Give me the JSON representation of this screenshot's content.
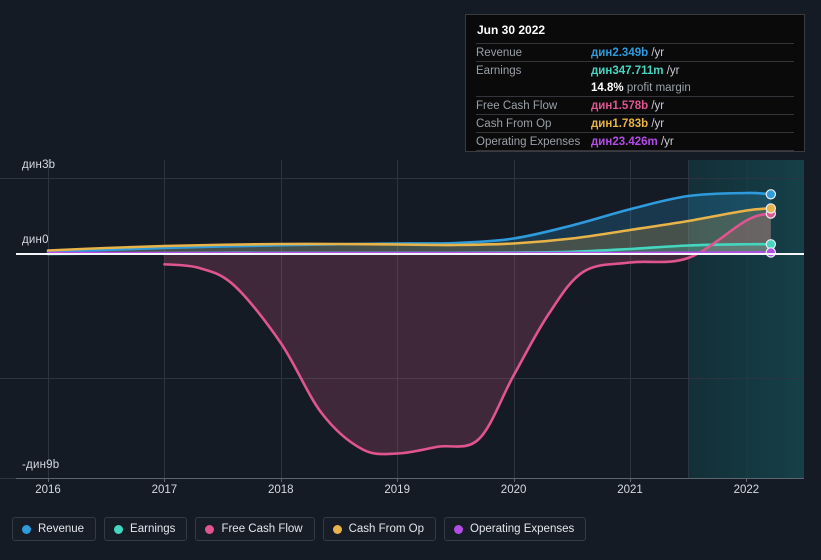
{
  "chart_data": {
    "type": "area",
    "title": "",
    "xlabel": "",
    "ylabel": "",
    "currency": "дин",
    "grid": true,
    "legend_position": "bottom-left",
    "xlim": [
      2015.72,
      2022.21
    ],
    "ylim": [
      -9,
      3
    ],
    "x_ticks": [
      2016,
      2017,
      2018,
      2019,
      2020,
      2021,
      2022
    ],
    "x_tick_labels": [
      "2016",
      "2017",
      "2018",
      "2019",
      "2020",
      "2021",
      "2022"
    ],
    "y_ticks": [
      3,
      0,
      -5,
      -9
    ],
    "y_tick_labels": [
      "дин3b",
      "дин0",
      "",
      "-дин9b"
    ],
    "forecast_start": 2021.5,
    "series": [
      {
        "name": "Revenue",
        "color": "#2e9bdd",
        "x": [
          2016.0,
          2016.5,
          2017.0,
          2017.5,
          2018.0,
          2018.5,
          2019.0,
          2019.5,
          2020.0,
          2020.5,
          2021.0,
          2021.5,
          2022.0,
          2022.21
        ],
        "values": [
          0.06,
          0.12,
          0.2,
          0.26,
          0.31,
          0.35,
          0.38,
          0.4,
          0.58,
          1.1,
          1.75,
          2.28,
          2.4,
          2.349
        ]
      },
      {
        "name": "Earnings",
        "color": "#45d6c0",
        "x": [
          2016.0,
          2016.5,
          2017.0,
          2017.5,
          2018.0,
          2018.5,
          2019.0,
          2019.5,
          2020.0,
          2020.5,
          2021.0,
          2021.5,
          2022.0,
          2022.21
        ],
        "values": [
          -0.04,
          -0.02,
          0.0,
          0.01,
          0.01,
          0.01,
          0.01,
          0.01,
          0.02,
          0.05,
          0.16,
          0.3,
          0.35,
          0.3477
        ]
      },
      {
        "name": "Free Cash Flow",
        "color": "#e0558f",
        "x": [
          2017.0,
          2017.3,
          2017.6,
          2018.0,
          2018.35,
          2018.7,
          2019.0,
          2019.35,
          2019.7,
          2020.0,
          2020.3,
          2020.6,
          2021.0,
          2021.5,
          2022.0,
          2022.21
        ],
        "values": [
          -0.45,
          -0.6,
          -1.3,
          -3.6,
          -6.4,
          -7.85,
          -8.02,
          -7.75,
          -7.45,
          -4.9,
          -2.45,
          -0.75,
          -0.38,
          -0.2,
          1.3,
          1.578
        ]
      },
      {
        "name": "Cash From Op",
        "color": "#e8b348",
        "x": [
          2016.0,
          2016.5,
          2017.0,
          2017.5,
          2018.0,
          2018.5,
          2019.0,
          2019.5,
          2020.0,
          2020.5,
          2021.0,
          2021.5,
          2022.0,
          2022.21
        ],
        "values": [
          0.1,
          0.2,
          0.28,
          0.33,
          0.36,
          0.36,
          0.34,
          0.32,
          0.38,
          0.58,
          0.92,
          1.28,
          1.7,
          1.783
        ]
      },
      {
        "name": "Operating Expenses",
        "color": "#b44ce8",
        "x": [
          2016.0,
          2017.0,
          2018.0,
          2019.0,
          2020.0,
          2021.0,
          2022.0,
          2022.21
        ],
        "values": [
          0.0,
          0.0,
          0.0,
          0.0,
          0.0,
          0.0,
          0.02,
          0.0234
        ]
      }
    ]
  },
  "tooltip": {
    "title": "Jun 30 2022",
    "rows": [
      {
        "label": "Revenue",
        "currency": "дин",
        "value": "2.349b",
        "suffix": "/yr",
        "color": "#2e9bdd"
      },
      {
        "label": "Earnings",
        "currency": "дин",
        "value": "347.711m",
        "suffix": "/yr",
        "color": "#45d6c0"
      },
      {
        "label": "Free Cash Flow",
        "currency": "дин",
        "value": "1.578b",
        "suffix": "/yr",
        "color": "#e0558f"
      },
      {
        "label": "Cash From Op",
        "currency": "дин",
        "value": "1.783b",
        "suffix": "/yr",
        "color": "#e8b348"
      },
      {
        "label": "Operating Expenses",
        "currency": "дин",
        "value": "23.426m",
        "suffix": "/yr",
        "color": "#b44ce8"
      }
    ],
    "margin_value": "14.8%",
    "margin_label": "profit margin"
  },
  "axes": {
    "y_top_label": "дин3b",
    "y_zero_label": "дин0",
    "y_bottom_label": "-дин9b"
  },
  "legend": {
    "items": [
      {
        "label": "Revenue",
        "color": "#2e9bdd"
      },
      {
        "label": "Earnings",
        "color": "#45d6c0"
      },
      {
        "label": "Free Cash Flow",
        "color": "#e0558f"
      },
      {
        "label": "Cash From Op",
        "color": "#e8b348"
      },
      {
        "label": "Operating Expenses",
        "color": "#b44ce8"
      }
    ]
  }
}
